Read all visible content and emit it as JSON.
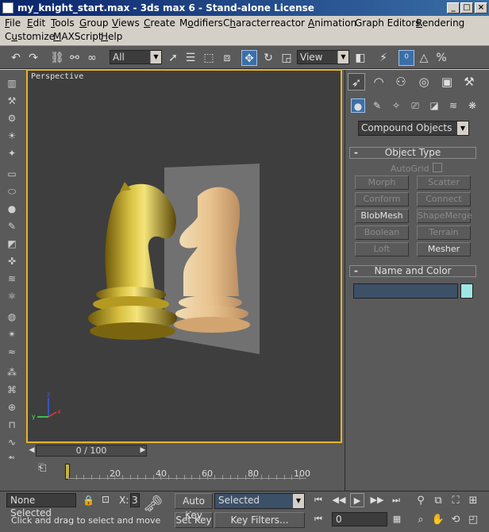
{
  "window": {
    "title": "my_knight_start.max - 3ds max 6 - Stand-alone License"
  },
  "menu": [
    {
      "label": "File",
      "u": "F"
    },
    {
      "label": "Edit",
      "u": "E"
    },
    {
      "label": "Tools",
      "u": "T"
    },
    {
      "label": "Group",
      "u": "G"
    },
    {
      "label": "Views",
      "u": "V"
    },
    {
      "label": "Create",
      "u": "C"
    },
    {
      "label": "Modifiers",
      "u": "o"
    },
    {
      "label": "Character",
      "u": "h"
    },
    {
      "label": "reactor",
      "u": ""
    },
    {
      "label": "Animation",
      "u": "A"
    },
    {
      "label": "Graph Editors",
      "u": ""
    },
    {
      "label": "Rendering",
      "u": "R"
    },
    {
      "label": "Customize",
      "u": "u"
    },
    {
      "label": "MAXScript",
      "u": "M"
    },
    {
      "label": "Help",
      "u": "H"
    }
  ],
  "toolbar": {
    "selection_filter": "All",
    "reference_coord": "View"
  },
  "viewport": {
    "label": "Perspective",
    "axis_x": "x",
    "axis_y": "y",
    "axis_z": "z"
  },
  "timeline": {
    "slider_label": "0 / 100",
    "ticks": [
      "20",
      "40",
      "60",
      "80",
      "100"
    ]
  },
  "command_panel": {
    "category": "Compound Objects",
    "object_type_title": "Object Type",
    "autogrid_label": "AutoGrid",
    "buttons": [
      {
        "label": "Morph",
        "enabled": false
      },
      {
        "label": "Scatter",
        "enabled": false
      },
      {
        "label": "Conform",
        "enabled": false
      },
      {
        "label": "Connect",
        "enabled": false
      },
      {
        "label": "BlobMesh",
        "enabled": true
      },
      {
        "label": "ShapeMerge",
        "enabled": false
      },
      {
        "label": "Boolean",
        "enabled": false
      },
      {
        "label": "Terrain",
        "enabled": false
      },
      {
        "label": "Loft",
        "enabled": false
      },
      {
        "label": "Mesher",
        "enabled": true
      }
    ],
    "name_color_title": "Name and Color",
    "swatch_color": "#9ee6e6"
  },
  "status": {
    "selection": "None Selected",
    "x_label": "X:",
    "x_value": "3",
    "prompt": "Click and drag to select and move",
    "auto_key": "Auto Key",
    "set_key": "Set Key",
    "key_mode": "Selected",
    "key_filters": "Key Filters...",
    "frame": "0"
  },
  "colors": {
    "viewport_border": "#e8b428",
    "active_button": "#3b6fa8",
    "title_bar": "#0a246a"
  }
}
